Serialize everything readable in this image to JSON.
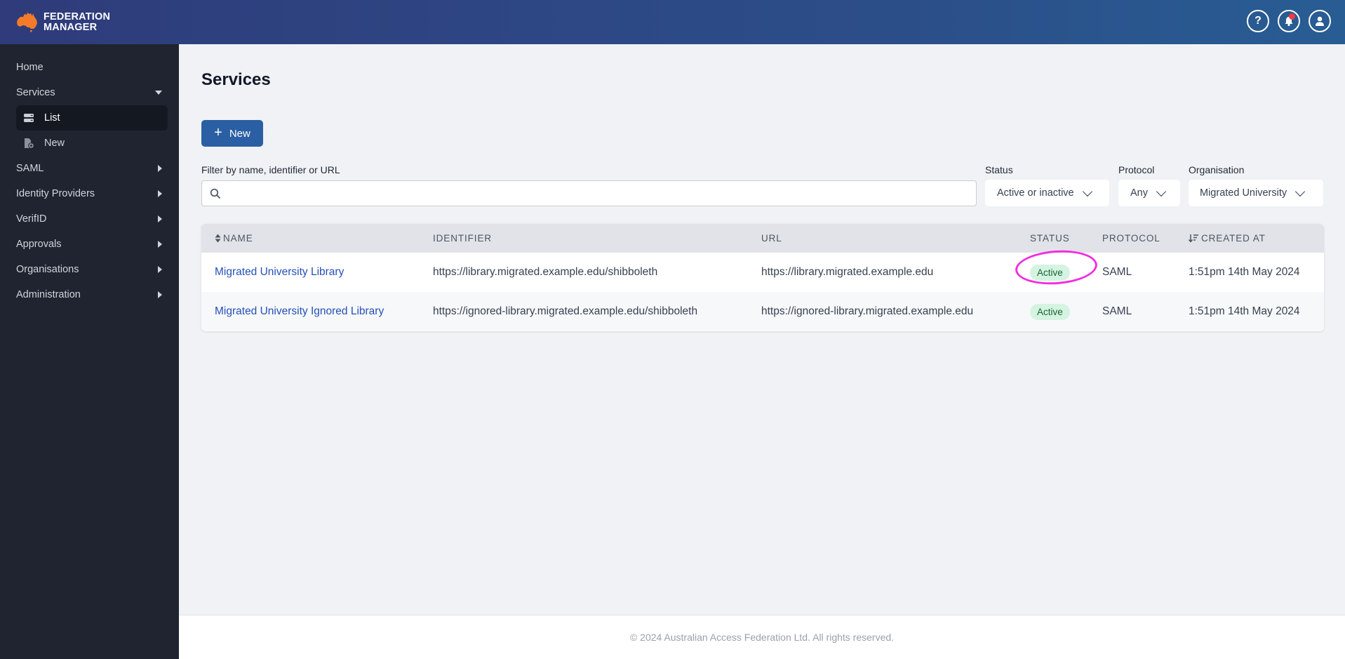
{
  "app": {
    "brand_line1": "FEDERATION",
    "brand_line2": "MANAGER",
    "accent_color": "#2b5fa3",
    "brand_color": "#f47b2a"
  },
  "topbar": {
    "icons": [
      {
        "name": "help-icon",
        "glyph": "?"
      },
      {
        "name": "notification-bell-icon",
        "has_unread": true
      },
      {
        "name": "user-account-icon"
      }
    ]
  },
  "sidebar": {
    "items": [
      {
        "label": "Home",
        "expandable": false
      },
      {
        "label": "Services",
        "expandable": true,
        "expanded": true,
        "children": [
          {
            "label": "List",
            "icon": "server-list-icon",
            "active": true
          },
          {
            "label": "New",
            "icon": "new-document-icon",
            "active": false
          }
        ]
      },
      {
        "label": "SAML",
        "expandable": true,
        "expanded": false
      },
      {
        "label": "Identity Providers",
        "expandable": true,
        "expanded": false
      },
      {
        "label": "VerifID",
        "expandable": true,
        "expanded": false
      },
      {
        "label": "Approvals",
        "expandable": true,
        "expanded": false
      },
      {
        "label": "Organisations",
        "expandable": true,
        "expanded": false
      },
      {
        "label": "Administration",
        "expandable": true,
        "expanded": false
      }
    ]
  },
  "main": {
    "title": "Services",
    "new_button": {
      "icon": "+",
      "label": "New"
    },
    "filters": {
      "search_label": "Filter by name, identifier or URL",
      "search_value": "",
      "search_placeholder": "",
      "status_label": "Status",
      "status_value": "Active or inactive",
      "protocol_label": "Protocol",
      "protocol_value": "Any",
      "organisation_label": "Organisation",
      "organisation_value": "Migrated University"
    },
    "table": {
      "columns": [
        {
          "label": "NAME",
          "sort_icon": "sort-both-icon"
        },
        {
          "label": "IDENTIFIER"
        },
        {
          "label": "URL"
        },
        {
          "label": "STATUS"
        },
        {
          "label": "PROTOCOL"
        },
        {
          "label": "CREATED AT",
          "sort_icon": "sort-descending-icon"
        }
      ],
      "rows": [
        {
          "name": "Migrated University Library",
          "identifier": "https://library.migrated.example.edu/shibboleth",
          "url": "https://library.migrated.example.edu",
          "status": "Active",
          "protocol": "SAML",
          "created_at": "1:51pm 14th May 2024"
        },
        {
          "name": "Migrated University Ignored Library",
          "identifier": "https://ignored-library.migrated.example.edu/shibboleth",
          "url": "https://ignored-library.migrated.example.edu",
          "status": "Active",
          "protocol": "SAML",
          "created_at": "1:51pm 14th May 2024"
        }
      ]
    },
    "annotation": {
      "target": "row-0-status",
      "color": "#f12ee0"
    }
  },
  "footer": {
    "text": "© 2024 Australian Access Federation Ltd. All rights reserved."
  }
}
